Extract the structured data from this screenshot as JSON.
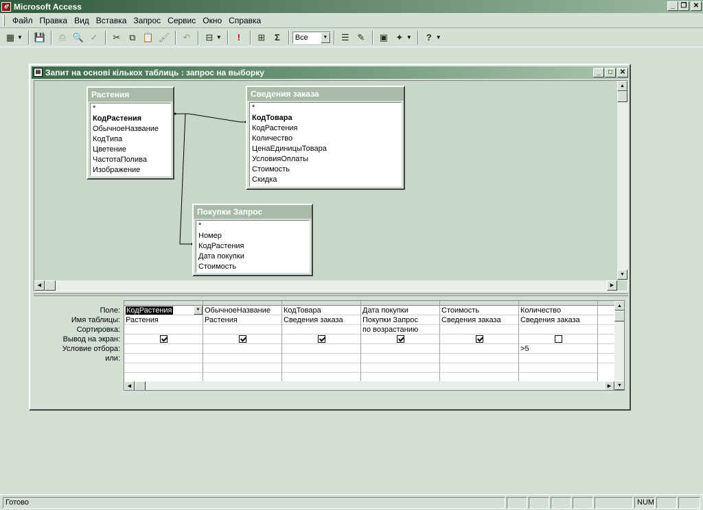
{
  "app": {
    "title": "Microsoft Access"
  },
  "menu": [
    "Файл",
    "Правка",
    "Вид",
    "Вставка",
    "Запрос",
    "Сервис",
    "Окно",
    "Справка"
  ],
  "toolbar": {
    "top_values": "Все"
  },
  "query_window": {
    "title": "Запит на основі кількох таблиць : запрос на выборку"
  },
  "tables": {
    "plants": {
      "name": "Растения",
      "fields": [
        "*",
        "КодРастения",
        "ОбычноеНазвание",
        "КодТипа",
        "Цветение",
        "ЧастотаПолива",
        "Изображение"
      ]
    },
    "order_details": {
      "name": "Сведения заказа",
      "fields": [
        "*",
        "КодТовара",
        "КодРастения",
        "Количество",
        "ЦенаЕдиницыТовара",
        "УсловияОплаты",
        "Стоимость",
        "Скидка"
      ]
    },
    "purchases": {
      "name": "Покупки Запрос",
      "fields": [
        "*",
        "Номер",
        "КодРастения",
        "Дата покупки",
        "Стоимость"
      ]
    }
  },
  "grid": {
    "row_labels": [
      "Поле:",
      "Имя таблицы:",
      "Сортировка:",
      "Вывод на экран:",
      "Условие отбора:",
      "или:"
    ],
    "columns": [
      {
        "field": "КодРастения",
        "table": "Растения",
        "sort": "",
        "show": true,
        "criteria": ""
      },
      {
        "field": "ОбычноеНазвание",
        "table": "Растения",
        "sort": "",
        "show": true,
        "criteria": ""
      },
      {
        "field": "КодТовара",
        "table": "Сведения заказа",
        "sort": "",
        "show": true,
        "criteria": ""
      },
      {
        "field": "Дата покупки",
        "table": "Покупки Запрос",
        "sort": "по возрастанию",
        "show": true,
        "criteria": ""
      },
      {
        "field": "Стоимость",
        "table": "Сведения заказа",
        "sort": "",
        "show": true,
        "criteria": ""
      },
      {
        "field": "Количество",
        "table": "Сведения заказа",
        "sort": "",
        "show": false,
        "criteria": ">5"
      }
    ]
  },
  "status": {
    "text": "Готово",
    "num": "NUM"
  }
}
